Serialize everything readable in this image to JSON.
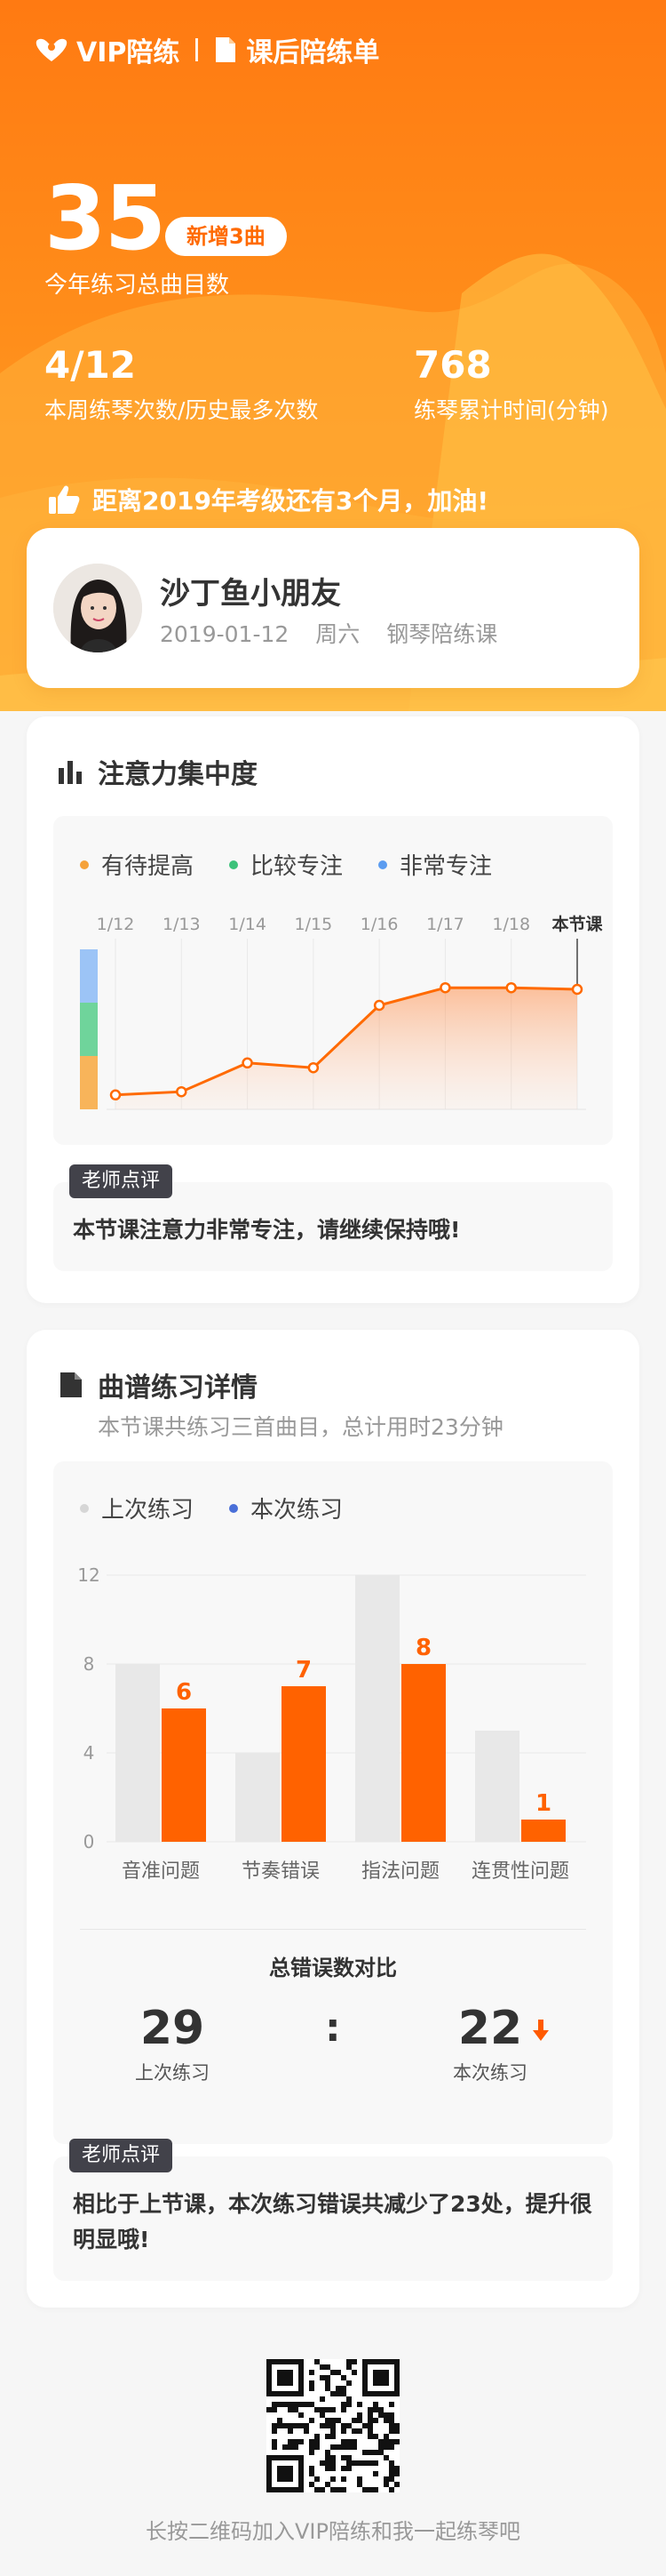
{
  "brand": {
    "name": "VIP陪练",
    "page_title": "课后陪练单"
  },
  "hero": {
    "total_songs": "35",
    "new_badge": "新增3曲",
    "total_label": "今年练习总曲目数",
    "week_stat": {
      "value": "4/12",
      "label": "本周练琴次数/历史最多次数"
    },
    "time_stat": {
      "value": "768",
      "label": "练琴累计时间(分钟)"
    },
    "slogan": "距离2019年考级还有3个月，加油!"
  },
  "student": {
    "name": "沙丁鱼小朋友",
    "date": "2019-01-12",
    "weekday": "周六",
    "course": "钢琴陪练课"
  },
  "attention": {
    "title": "注意力集中度",
    "legend": [
      {
        "label": "有待提高",
        "color": "#f5a23a"
      },
      {
        "label": "比较专注",
        "color": "#3cc27a"
      },
      {
        "label": "非常专注",
        "color": "#5b9cf0"
      }
    ],
    "comment_tag": "老师点评",
    "comment": "本节课注意力非常专注，请继续保持哦!",
    "chart_data": {
      "type": "area",
      "categories": [
        "1/12",
        "1/13",
        "1/14",
        "1/15",
        "1/16",
        "1/17",
        "1/18",
        "本节课"
      ],
      "values": [
        0.09,
        0.11,
        0.29,
        0.26,
        0.65,
        0.76,
        0.76,
        0.75
      ],
      "ylim": [
        0,
        1
      ],
      "bands": [
        "有待提高",
        "比较专注",
        "非常专注"
      ],
      "series_color": "#ff6a00",
      "grid": true
    }
  },
  "score": {
    "title": "曲谱练习详情",
    "subtitle": "本节课共练习三首曲目，总计用时23分钟",
    "legend": [
      {
        "label": "上次练习",
        "color": "#d6d6d6"
      },
      {
        "label": "本次练习",
        "color": "#4a6fd8"
      }
    ],
    "chart_data": {
      "type": "bar",
      "categories": [
        "音准问题",
        "节奏错误",
        "指法问题",
        "连贯性问题"
      ],
      "series": [
        {
          "name": "上次练习",
          "values": [
            8,
            4,
            12,
            5
          ]
        },
        {
          "name": "本次练习",
          "values": [
            6,
            7,
            8,
            1
          ]
        }
      ],
      "ylim": [
        0,
        12
      ],
      "yticks": [
        0,
        4,
        8,
        12
      ],
      "grid": true,
      "colors": [
        "#e8e8e8",
        "#ff6200"
      ]
    },
    "compare": {
      "title": "总错误数对比",
      "last_value": "29",
      "last_label": "上次练习",
      "separator": ":",
      "this_value": "22",
      "this_label": "本次练习"
    },
    "comment_tag": "老师点评",
    "comment": "相比于上节课，本次练习错误共减少了23处，提升很明显哦!"
  },
  "footer": {
    "caption": "长按二维码加入VIP陪练和我一起练琴吧"
  }
}
